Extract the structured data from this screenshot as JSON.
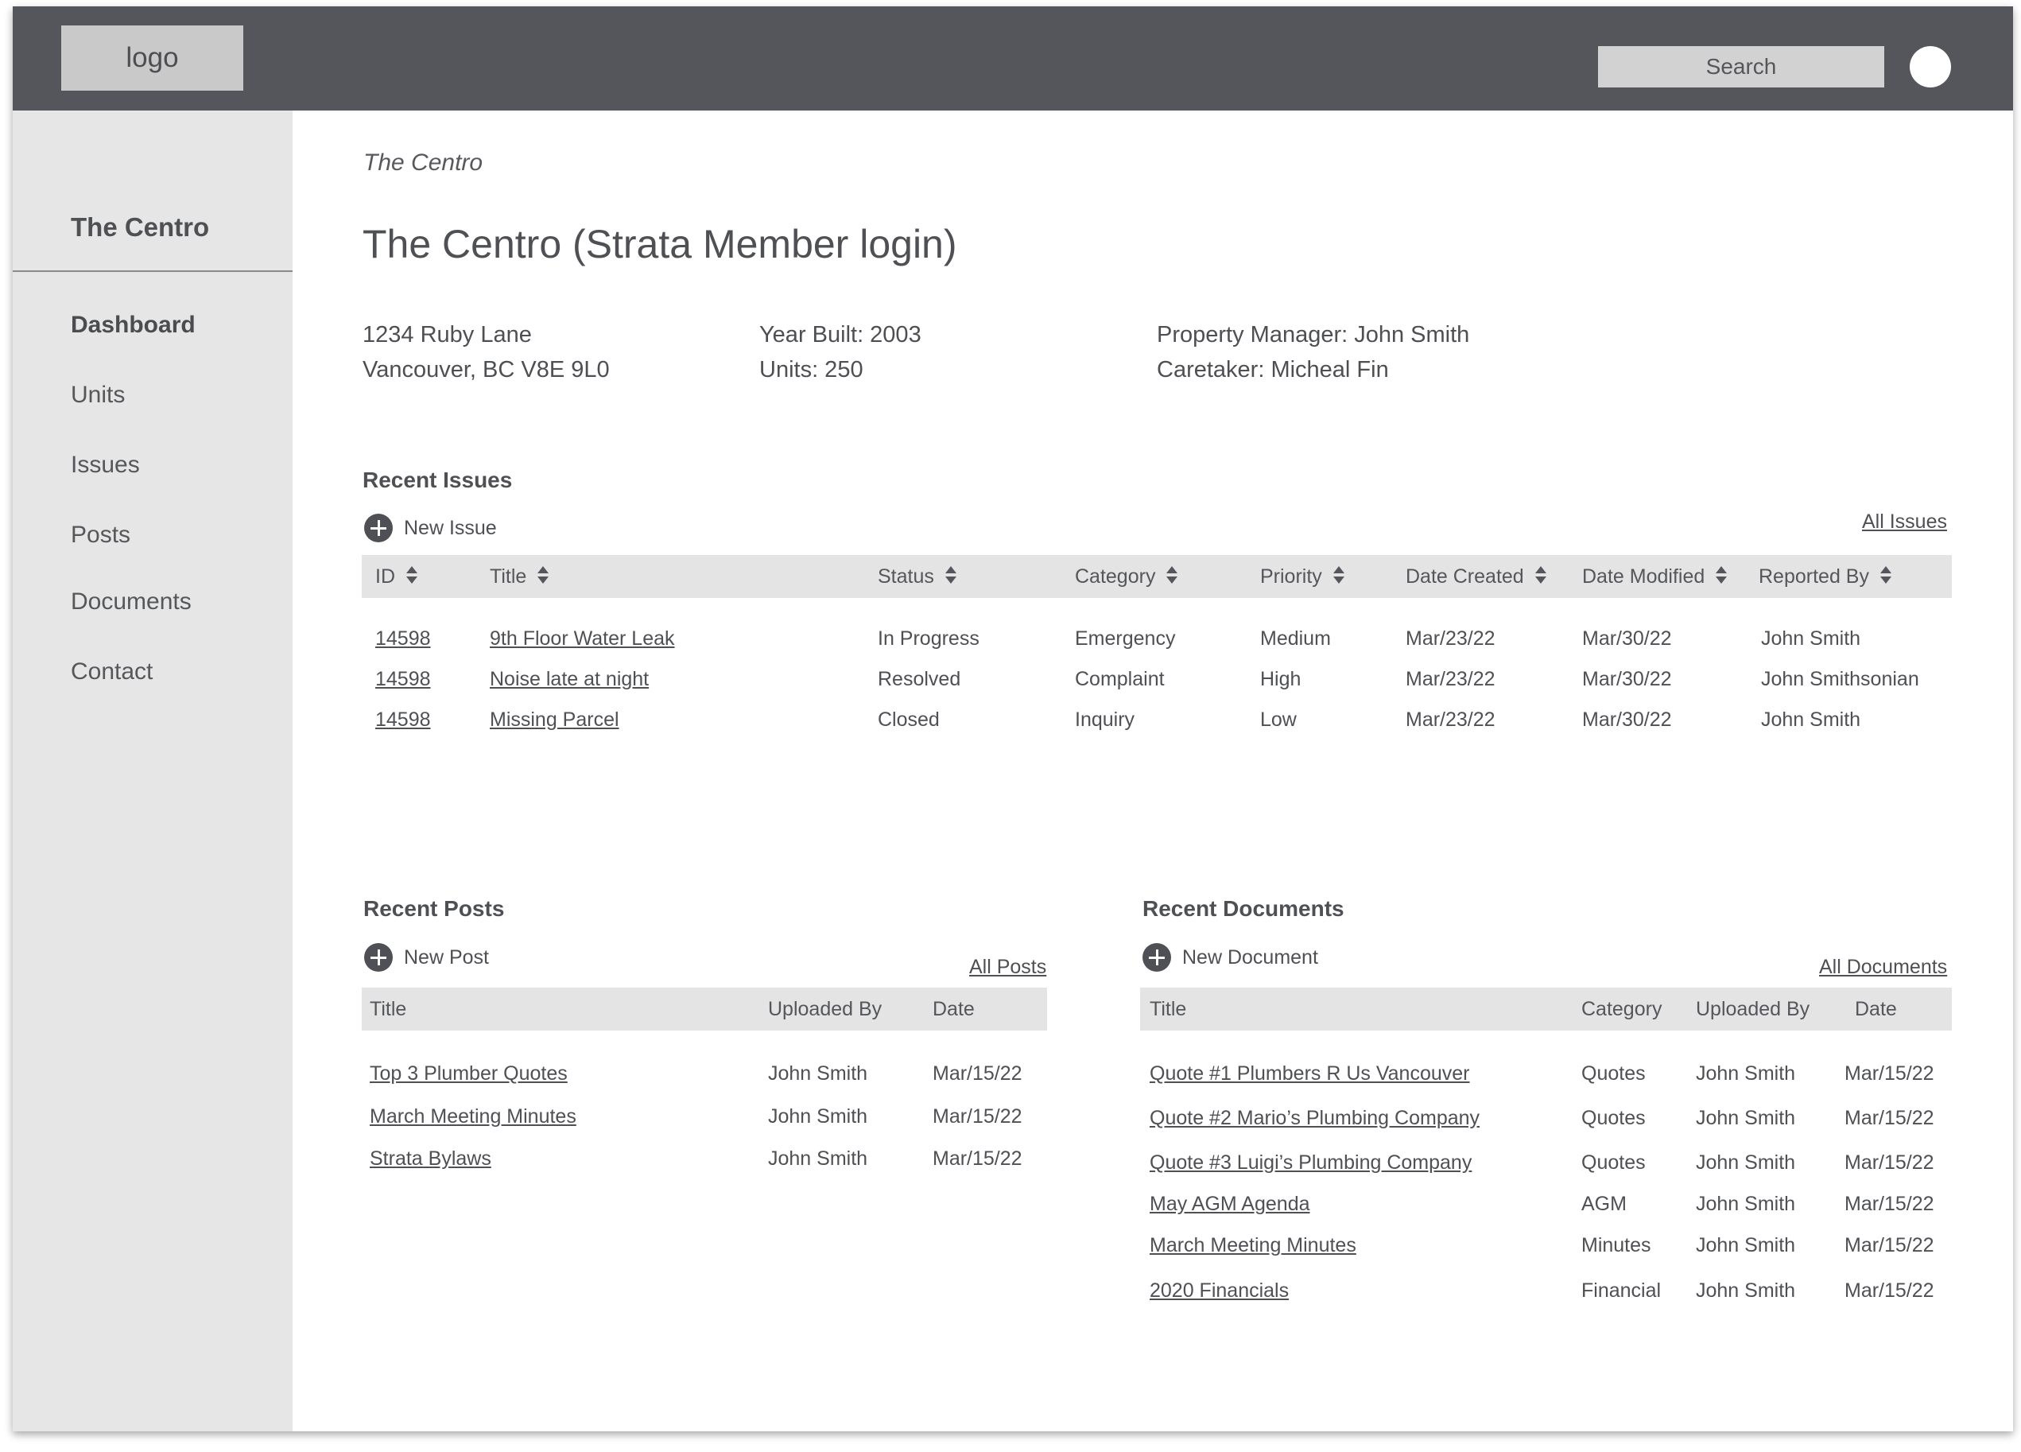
{
  "header": {
    "logo": "logo",
    "search_placeholder": "Search"
  },
  "sidebar": {
    "title": "The Centro",
    "items": [
      {
        "label": "Dashboard",
        "active": true
      },
      {
        "label": "Units"
      },
      {
        "label": "Issues"
      },
      {
        "label": "Posts"
      },
      {
        "label": "Documents"
      },
      {
        "label": "Contact"
      }
    ]
  },
  "page": {
    "breadcrumb": "The Centro",
    "title": "The Centro (Strata Member login)",
    "address_line1": "1234 Ruby Lane",
    "address_line2": "Vancouver, BC V8E 9L0",
    "year_built": "Year Built: 2003",
    "units": "Units: 250",
    "property_manager": "Property Manager: John Smith",
    "caretaker": "Caretaker: Micheal Fin"
  },
  "issues": {
    "title": "Recent Issues",
    "new_label": "New Issue",
    "all_label": "All Issues",
    "columns": [
      "ID",
      "Title",
      "Status",
      "Category",
      "Priority",
      "Date Created",
      "Date Modified",
      "Reported By"
    ],
    "rows": [
      [
        "14598",
        "9th Floor Water Leak",
        "In Progress",
        "Emergency",
        "Medium",
        "Mar/23/22",
        "Mar/30/22",
        "John Smith"
      ],
      [
        "14598",
        "Noise late at night",
        "Resolved",
        "Complaint",
        "High",
        "Mar/23/22",
        "Mar/30/22",
        "John Smithsonian"
      ],
      [
        "14598",
        "Missing Parcel",
        "Closed",
        "Inquiry",
        "Low",
        "Mar/23/22",
        "Mar/30/22",
        "John Smith"
      ]
    ]
  },
  "posts": {
    "title": "Recent Posts",
    "new_label": "New Post",
    "all_label": "All Posts",
    "columns": [
      "Title",
      "Uploaded By",
      "Date"
    ],
    "rows": [
      [
        "Top 3 Plumber Quotes",
        "John Smith",
        "Mar/15/22"
      ],
      [
        "March Meeting Minutes",
        "John Smith",
        "Mar/15/22"
      ],
      [
        "Strata Bylaws",
        "John Smith",
        "Mar/15/22"
      ]
    ]
  },
  "documents": {
    "title": "Recent Documents",
    "new_label": "New Document",
    "all_label": "All Documents",
    "columns": [
      "Title",
      "Category",
      "Uploaded By",
      "Date"
    ],
    "rows": [
      [
        "Quote #1 Plumbers R Us Vancouver",
        "Quotes",
        "John Smith",
        "Mar/15/22"
      ],
      [
        "Quote #2 Mario’s Plumbing Company",
        "Quotes",
        "John Smith",
        "Mar/15/22"
      ],
      [
        "Quote #3 Luigi’s Plumbing Company",
        "Quotes",
        "John Smith",
        "Mar/15/22"
      ],
      [
        "May AGM Agenda",
        "AGM",
        "John Smith",
        "Mar/15/22"
      ],
      [
        "March Meeting Minutes",
        "Minutes",
        "John Smith",
        "Mar/15/22"
      ],
      [
        "2020 Financials",
        "Financial",
        "John Smith",
        "Mar/15/22"
      ]
    ]
  }
}
